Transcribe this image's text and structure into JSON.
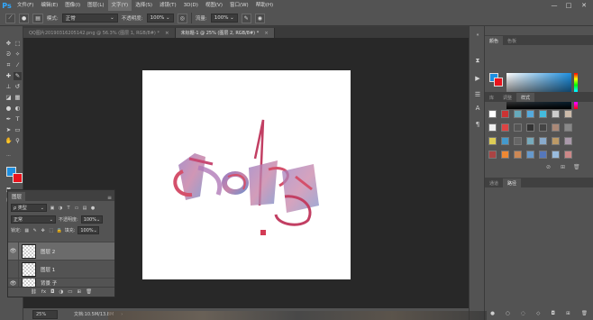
{
  "app": {
    "logo": "Ps"
  },
  "menu": [
    "文件(F)",
    "编辑(E)",
    "图像(I)",
    "图层(L)",
    "文字(Y)",
    "选择(S)",
    "滤镜(T)",
    "3D(D)",
    "视图(V)",
    "窗口(W)",
    "帮助(H)"
  ],
  "window_controls": {
    "minimize": "—",
    "maximize": "□",
    "close": "✕"
  },
  "options": {
    "mode_label": "模式:",
    "mode_value": "正常",
    "opacity_label": "不透明度:",
    "opacity_value": "100%",
    "flow_label": "流量:",
    "flow_value": "100%"
  },
  "tabs": [
    {
      "label": "QQ图片20190316205142.png @ 56.3% (图层 1, RGB/8#) *",
      "close": "×"
    },
    {
      "label": "未标题-1 @ 25% (图层 2, RGB/8#) *",
      "close": "×"
    }
  ],
  "color_panel": {
    "tab_color": "颜色",
    "tab_swatches": "色板",
    "foreground": "#1d8fe0",
    "background": "#e8131c"
  },
  "adjust_panel": {
    "tab_library": "库",
    "tab_adjust": "调整",
    "tab_styles": "样式"
  },
  "paths_panel": {
    "tab_channels": "通道",
    "tab_paths": "路径"
  },
  "layers": {
    "title": "图层",
    "kind_label": "ρ 类型",
    "blend": "正常",
    "opacity_label": "不透明度:",
    "opacity_value": "100%",
    "lock_label": "锁定:",
    "fill_label": "填充:",
    "fill_value": "100%",
    "items": [
      {
        "name": "图层 2",
        "selected": true
      },
      {
        "name": "图层 1",
        "selected": false
      },
      {
        "name": "背景 子",
        "selected": false
      }
    ]
  },
  "status": {
    "zoom": "25%",
    "doc": "文档:10.5M/13.8M"
  }
}
